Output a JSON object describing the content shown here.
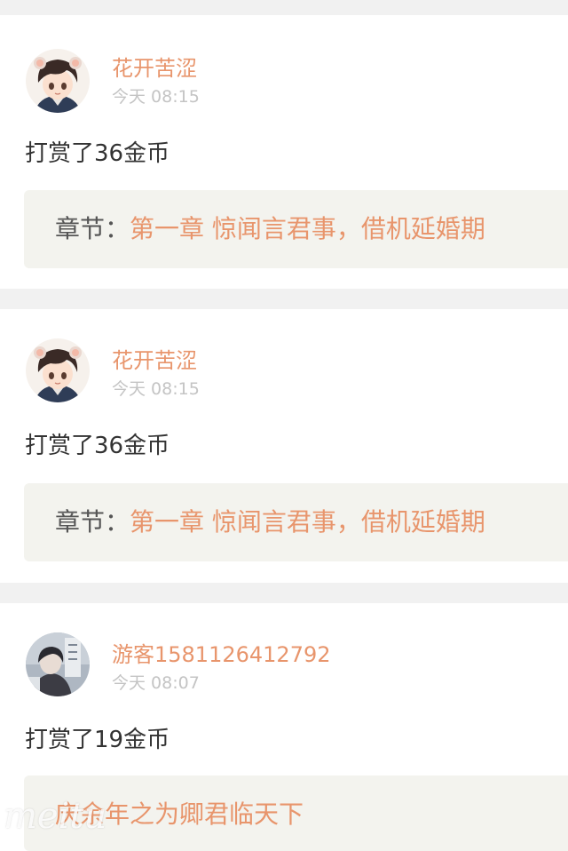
{
  "entries": [
    {
      "username": "花开苦涩",
      "time": "今天 08:15",
      "reward": "打赏了36金币",
      "chapter_prefix": "章节：",
      "chapter_title": "第一章  惊闻言君事，借机延婚期",
      "avatar": "anime-boy-avatar"
    },
    {
      "username": "花开苦涩",
      "time": "今天 08:15",
      "reward": "打赏了36金币",
      "chapter_prefix": "章节：",
      "chapter_title": "第一章  惊闻言君事，借机延婚期",
      "avatar": "anime-boy-avatar"
    },
    {
      "username": "游客1581126412792",
      "time": "今天 08:07",
      "reward": "打赏了19金币",
      "chapter_prefix": "",
      "chapter_title": "庆余年之为卿君临天下",
      "avatar": "guest-photo-avatar"
    }
  ],
  "watermark": "meitu",
  "colors": {
    "accent": "#e8956c",
    "muted": "#c4c4c4",
    "text": "#333333",
    "box": "#f3f3ee",
    "separator": "#f1f1f1"
  }
}
